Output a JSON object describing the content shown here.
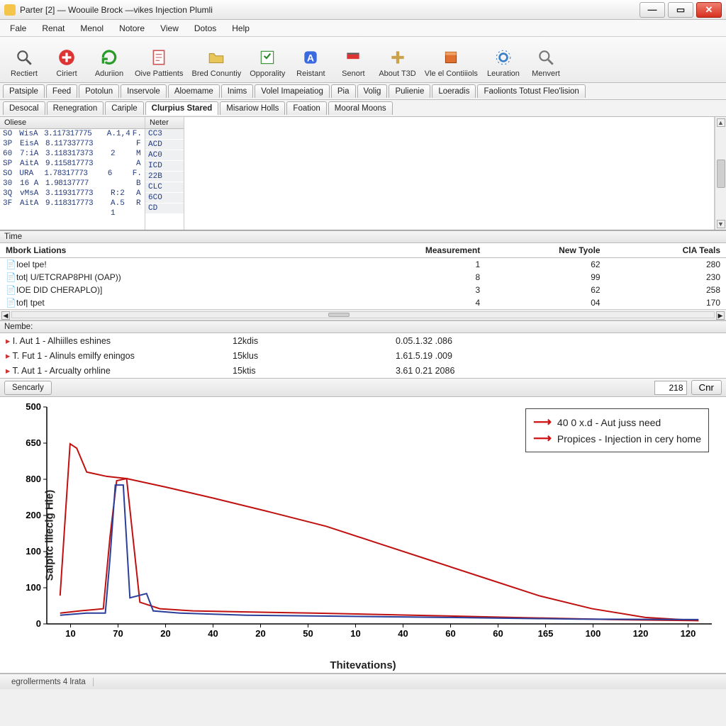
{
  "window": {
    "title": "Parter [2] — Woouile Brock —vikes Injection Plumli"
  },
  "menu": [
    "Fale",
    "Renat",
    "Menol",
    "Notore",
    "View",
    "Dotos",
    "Help"
  ],
  "toolbar": [
    {
      "label": "Rectiert",
      "icon": "search"
    },
    {
      "label": "Ciriert",
      "icon": "plus"
    },
    {
      "label": "Aduriion",
      "icon": "refresh"
    },
    {
      "label": "Oive Pattients",
      "icon": "doc"
    },
    {
      "label": "Bred Conuntiy",
      "icon": "folder"
    },
    {
      "label": "Opporality",
      "icon": "note"
    },
    {
      "label": "Reistant",
      "icon": "app"
    },
    {
      "label": "Senort",
      "icon": "flag"
    },
    {
      "label": "About T3D",
      "icon": "plus2"
    },
    {
      "label": "Vle el Contiiiols",
      "icon": "book"
    },
    {
      "label": "Leuration",
      "icon": "gear"
    },
    {
      "label": "Menvert",
      "icon": "search2"
    }
  ],
  "tabsTop": [
    "Patsiple",
    "Feed",
    "Potolun",
    "Inservole",
    "Aloemame",
    "Inims",
    "Volel Imapeiatiog",
    "Pia",
    "Volig",
    "Pulienie",
    "Loeradis",
    "Faolionts Totust Fleo'lision"
  ],
  "tabsSub": [
    "Desocal",
    "Renegration",
    "Cariple",
    "Clurpius Stared",
    "Misariow Holls",
    "Foation",
    "Mooral Moons"
  ],
  "activeSubTab": 3,
  "upperCols": {
    "office": {
      "head": "Oliese",
      "rows": [
        {
          "a": "SO",
          "b": "WisA",
          "c": "3.117317775",
          "d": "A.1,4",
          "e": "F."
        },
        {
          "a": "3P",
          "b": "EisA",
          "c": "8.117337773",
          "d": "",
          "e": "F"
        },
        {
          "a": "60",
          "b": "7:iA",
          "c": "3.118317373",
          "d": "2",
          "e": "M"
        },
        {
          "a": "SP",
          "b": "AitA",
          "c": "9.115817773",
          "d": "",
          "e": "A"
        },
        {
          "a": "SO",
          "b": "URA",
          "c": "1.78317773",
          "d": "6",
          "e": "F."
        },
        {
          "a": "30",
          "b": "16 A",
          "c": "1.98137777",
          "d": "",
          "e": "B"
        },
        {
          "a": "3Q",
          "b": "vMsA",
          "c": "3.119317773",
          "d": "R:2",
          "e": "A"
        },
        {
          "a": "3F",
          "b": "AitA",
          "c": "9.118317773",
          "d": "A.5",
          "e": "R"
        },
        {
          "a": "",
          "b": "",
          "c": "",
          "d": "1",
          "e": ""
        }
      ]
    },
    "noter": {
      "head": "Neter",
      "rows": [
        "CC3",
        "ACD",
        "AC0",
        "ICD",
        "22B",
        "CLC",
        "6CO",
        "CD"
      ]
    }
  },
  "timeHead": "Time",
  "midTable": {
    "cols": [
      "Mbork Liations",
      "Measurement",
      "New Tyole",
      "ClA Teals"
    ],
    "rows": [
      {
        "c0": "Ioel tpe!",
        "c1": "1",
        "c2": "62",
        "c3": "280"
      },
      {
        "c0": "tot| U/ETCRAP8PHI (OAP))",
        "c1": "8",
        "c2": "99",
        "c3": "230"
      },
      {
        "c0": "IOE  DID CHERAPLO)]",
        "c1": "3",
        "c2": "62",
        "c3": "258"
      },
      {
        "c0": "tof| tpet",
        "c1": "4",
        "c2": "04",
        "c3": "170"
      }
    ]
  },
  "nembeHead": "Nembe:",
  "lowTable": [
    {
      "c0": "I. Aut 1 -  Alhiilles eshines",
      "c1": "12kdis",
      "c2": "0.05.1.32 .086"
    },
    {
      "c0": "T. Fut 1 -  Alinuls emilfy eningos",
      "c1": "15klus",
      "c2": "1.61.5.19 .009"
    },
    {
      "c0": "T. Aut 1 -  Arcualty orhline",
      "c1": "15ktis",
      "c2": "3.61 0.21 2086"
    }
  ],
  "chartTab": "Sencarly",
  "chartInput": "218",
  "chartBtn": "Cnr",
  "chart_data": {
    "type": "line",
    "ylabel": "Saipitc liiecig Hie)",
    "xlabel": "Thitevations)",
    "yticks": [
      500,
      650,
      800,
      200,
      100,
      100,
      0
    ],
    "xticks": [
      10,
      70,
      20,
      40,
      20,
      50,
      10,
      40,
      60,
      60,
      165,
      100,
      120,
      120
    ],
    "ylim": [
      0,
      800
    ],
    "legend": [
      {
        "name": "40 0 x.d - Aut juss need",
        "color": "#d01010"
      },
      {
        "name": "Propices - Injection in cery home",
        "color": "#d01010"
      }
    ],
    "series": [
      {
        "name": "red-outer",
        "color": "#c01010",
        "values": [
          [
            0.02,
            0.13
          ],
          [
            0.035,
            0.83
          ],
          [
            0.045,
            0.81
          ],
          [
            0.06,
            0.7
          ],
          [
            0.09,
            0.68
          ],
          [
            0.12,
            0.67
          ],
          [
            0.18,
            0.63
          ],
          [
            0.25,
            0.58
          ],
          [
            0.33,
            0.52
          ],
          [
            0.42,
            0.45
          ],
          [
            0.5,
            0.37
          ],
          [
            0.58,
            0.29
          ],
          [
            0.66,
            0.21
          ],
          [
            0.74,
            0.13
          ],
          [
            0.82,
            0.07
          ],
          [
            0.9,
            0.03
          ],
          [
            0.98,
            0.015
          ]
        ]
      },
      {
        "name": "red-lower",
        "color": "#c01010",
        "values": [
          [
            0.02,
            0.05
          ],
          [
            0.05,
            0.06
          ],
          [
            0.085,
            0.07
          ],
          [
            0.095,
            0.4
          ],
          [
            0.105,
            0.66
          ],
          [
            0.12,
            0.67
          ],
          [
            0.14,
            0.1
          ],
          [
            0.17,
            0.07
          ],
          [
            0.22,
            0.06
          ],
          [
            0.3,
            0.055
          ],
          [
            0.4,
            0.05
          ],
          [
            0.55,
            0.04
          ],
          [
            0.7,
            0.03
          ],
          [
            0.85,
            0.02
          ],
          [
            0.98,
            0.015
          ]
        ]
      },
      {
        "name": "blue",
        "color": "#2a3f9a",
        "values": [
          [
            0.02,
            0.04
          ],
          [
            0.06,
            0.05
          ],
          [
            0.088,
            0.05
          ],
          [
            0.095,
            0.3
          ],
          [
            0.103,
            0.64
          ],
          [
            0.115,
            0.64
          ],
          [
            0.125,
            0.12
          ],
          [
            0.15,
            0.14
          ],
          [
            0.16,
            0.06
          ],
          [
            0.2,
            0.05
          ],
          [
            0.3,
            0.04
          ],
          [
            0.45,
            0.035
          ],
          [
            0.6,
            0.03
          ],
          [
            0.8,
            0.022
          ],
          [
            0.98,
            0.02
          ]
        ]
      }
    ]
  },
  "status": "egrollerments 4 lrata"
}
